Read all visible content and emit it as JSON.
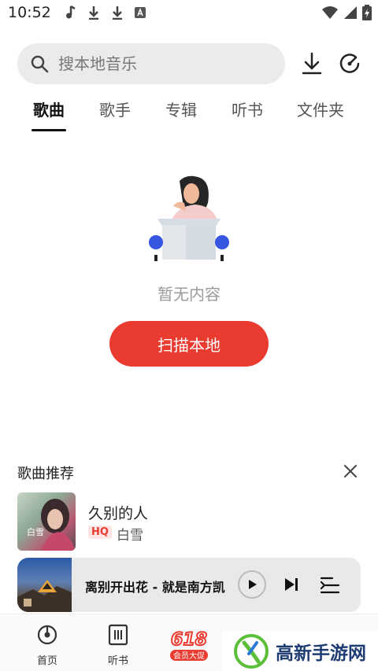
{
  "status_bar": {
    "time": "10:52"
  },
  "search": {
    "placeholder": "搜本地音乐"
  },
  "tabs": [
    {
      "label": "歌曲",
      "active": true
    },
    {
      "label": "歌手",
      "active": false
    },
    {
      "label": "专辑",
      "active": false
    },
    {
      "label": "听书",
      "active": false
    },
    {
      "label": "文件夹",
      "active": false
    }
  ],
  "empty_state": {
    "message": "暂无内容",
    "button_label": "扫描本地"
  },
  "recommend": {
    "title": "歌曲推荐",
    "item": {
      "song": "久别的人",
      "quality": "HQ",
      "artist": "白雪",
      "cover_text": "白雪"
    }
  },
  "player": {
    "now_playing": "离别开出花 - 就是南方凯"
  },
  "bottom_nav": [
    {
      "label": "首页"
    },
    {
      "label": "听书"
    }
  ],
  "promo": {
    "number": "618",
    "text": "会员大促"
  },
  "watermark": {
    "text": "高新手游网"
  },
  "colors": {
    "accent": "#e93b2f",
    "search_bg": "#ebebeb",
    "player_bg": "#e9e9e9"
  }
}
